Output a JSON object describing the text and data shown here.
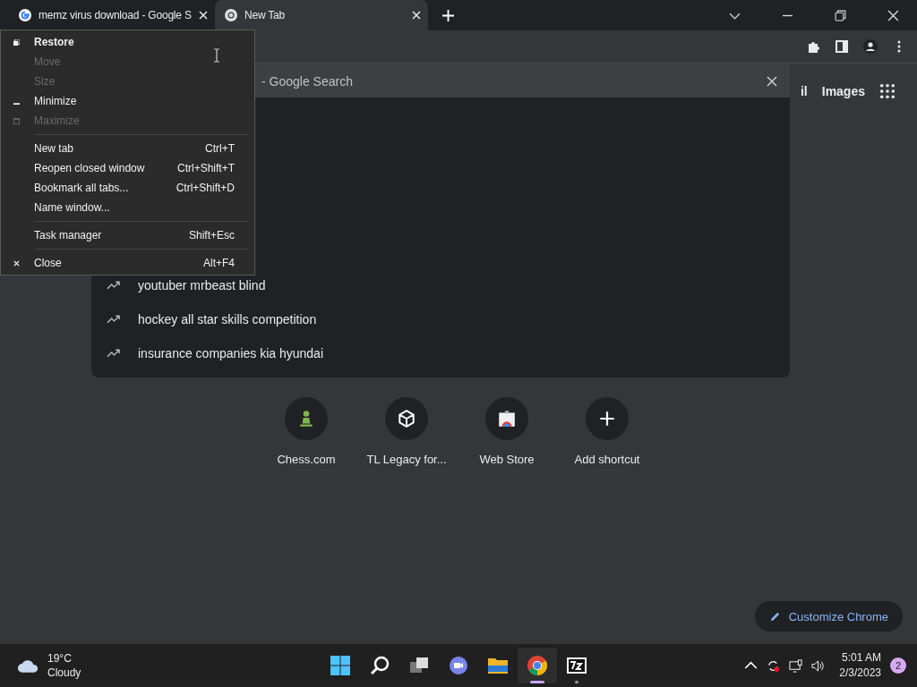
{
  "tabs": [
    {
      "title": "memz virus download - Google S",
      "selected": false
    },
    {
      "title": "New Tab",
      "selected": true
    }
  ],
  "omnibox": {
    "value": "- Google Search",
    "suggestions": [
      {
        "text": "youtuber mrbeast blind"
      },
      {
        "text": "hockey all star skills competition"
      },
      {
        "text": "insurance companies kia hyundai"
      }
    ]
  },
  "header_links": [
    "il",
    "Images"
  ],
  "shortcuts": [
    {
      "label": "Chess.com"
    },
    {
      "label": "TL Legacy for..."
    },
    {
      "label": "Web Store"
    },
    {
      "label": "Add shortcut"
    }
  ],
  "customize_button": "Customize Chrome",
  "system_menu": [
    {
      "kind": "item",
      "label": "Restore",
      "disabled": false,
      "default": true
    },
    {
      "kind": "item",
      "label": "Move",
      "disabled": true,
      "default": false
    },
    {
      "kind": "item",
      "label": "Size",
      "disabled": true,
      "default": false
    },
    {
      "kind": "item",
      "label": "Minimize",
      "disabled": false,
      "default": false
    },
    {
      "kind": "item",
      "label": "Maximize",
      "disabled": true,
      "default": false
    },
    {
      "kind": "separator"
    },
    {
      "kind": "item",
      "label": "New tab",
      "shortcut": "Ctrl+T",
      "disabled": false,
      "default": false
    },
    {
      "kind": "item",
      "label": "Reopen closed window",
      "shortcut": "Ctrl+Shift+T",
      "disabled": false,
      "default": false
    },
    {
      "kind": "item",
      "label": "Bookmark all tabs...",
      "shortcut": "Ctrl+Shift+D",
      "disabled": false,
      "default": false
    },
    {
      "kind": "item",
      "label": "Name window...",
      "disabled": false,
      "default": false
    },
    {
      "kind": "separator"
    },
    {
      "kind": "item",
      "label": "Task manager",
      "shortcut": "Shift+Esc",
      "disabled": false,
      "default": false
    },
    {
      "kind": "separator"
    },
    {
      "kind": "item",
      "label": "Close",
      "shortcut": "Alt+F4",
      "disabled": false,
      "default": false
    }
  ],
  "taskbar": {
    "weather": {
      "temp": "19°C",
      "condition": "Cloudy"
    },
    "apps": [
      {
        "active": false
      },
      {
        "active": false
      },
      {
        "active": false
      },
      {
        "active": false
      },
      {
        "active": false
      },
      {
        "active": true
      },
      {
        "active": false
      }
    ],
    "time": "5:01 AM",
    "date": "2/3/2023",
    "notifications": "2"
  }
}
